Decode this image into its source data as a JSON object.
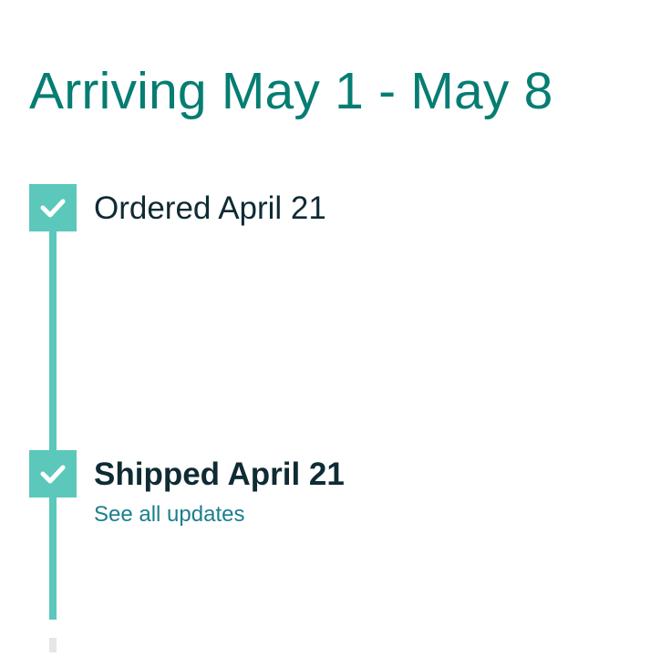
{
  "delivery": {
    "heading": "Arriving May 1 - May 8"
  },
  "timeline": {
    "steps": [
      {
        "label": "Ordered April 21",
        "completed": true,
        "emphasized": false
      },
      {
        "label": "Shipped April 21",
        "completed": true,
        "emphasized": true,
        "link": "See all updates"
      },
      {
        "label": "",
        "completed": false
      }
    ],
    "icons": {
      "completed": "checkmark-icon"
    },
    "colors": {
      "heading": "#067d72",
      "progress": "#5bc8bb",
      "pending": "#e6e6e6",
      "text": "#0f2b33",
      "link": "#1a7f8e"
    }
  }
}
